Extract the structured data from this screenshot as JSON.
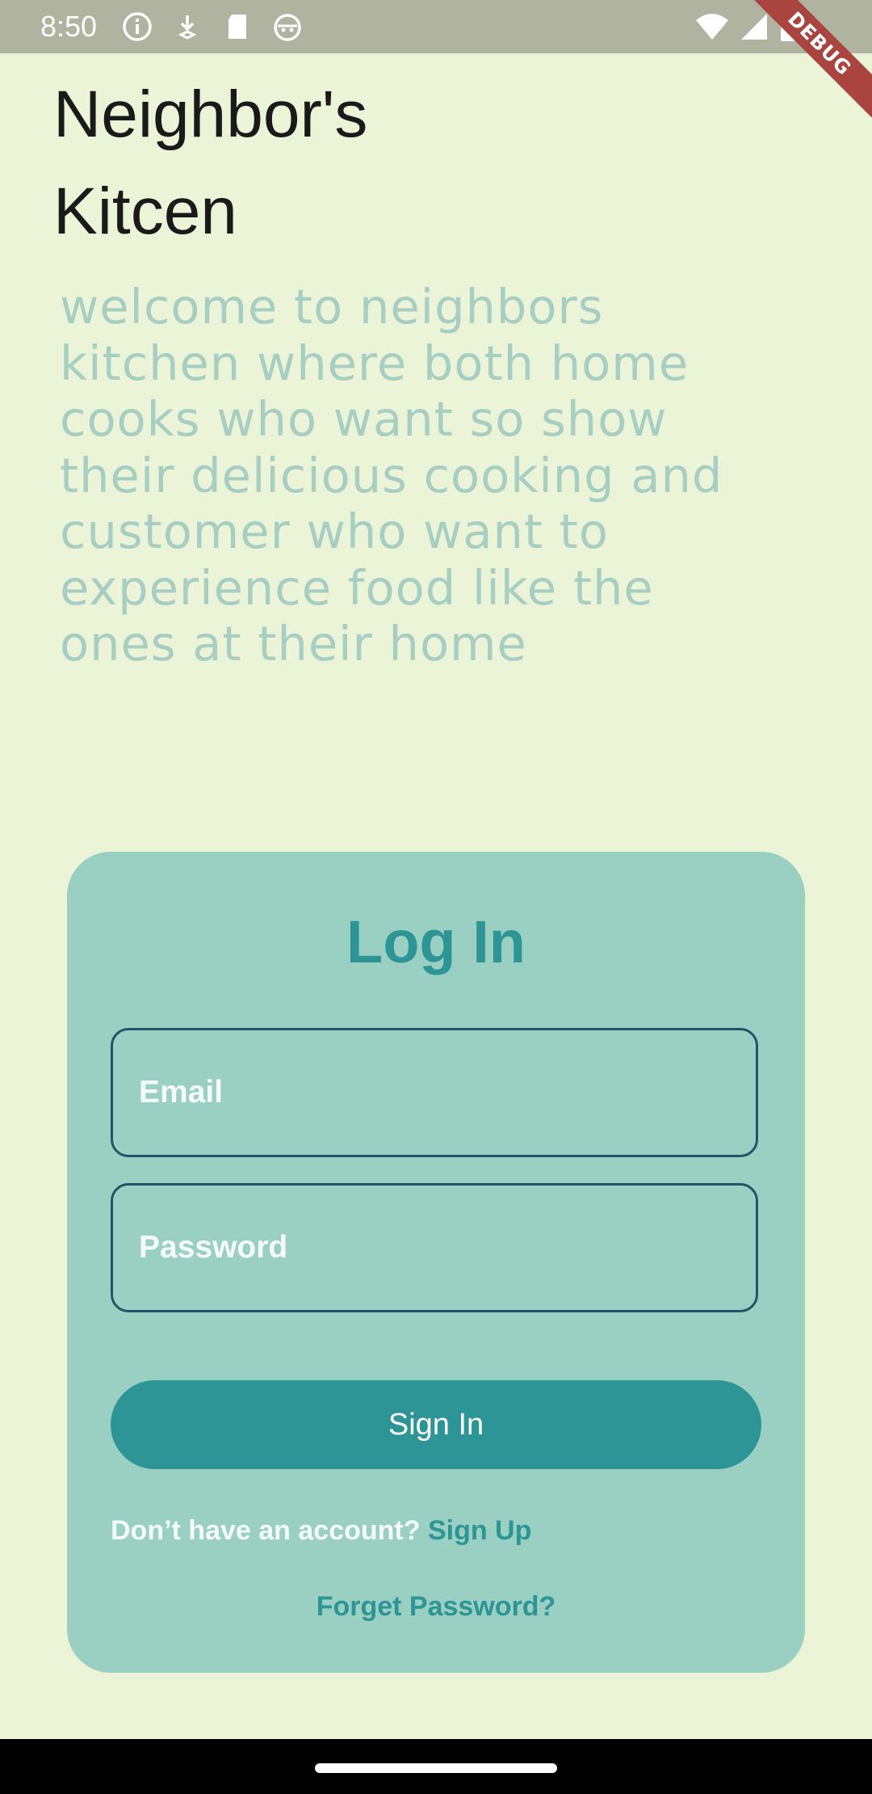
{
  "status_bar": {
    "time": "8:50",
    "left_icons": [
      "info-icon",
      "download-icon",
      "sd-card-icon",
      "android-face-icon"
    ],
    "right_icons": [
      "wifi-icon",
      "signal-icon",
      "battery-icon"
    ]
  },
  "debug_banner": {
    "label": "DEBUG",
    "color": "#A9443E"
  },
  "app": {
    "title": "Neighbor's Kitcen",
    "welcome": "welcome to neighbors kitchen where both home cooks who want so show their delicious cooking and customer who want to experience food like the ones at their home"
  },
  "login": {
    "heading": "Log In",
    "email_placeholder": "Email",
    "password_placeholder": "Password",
    "sign_in_label": "Sign In",
    "signup_prompt": "Don’t have an account?",
    "signup_link": "Sign Up",
    "forgot_link": "Forget Password?"
  },
  "colors": {
    "background": "#EBF4D7",
    "card": "#9AD0C2",
    "accent": "#2D9596",
    "field_border": "#26516B",
    "welcome_text": "#A7CEC3"
  }
}
